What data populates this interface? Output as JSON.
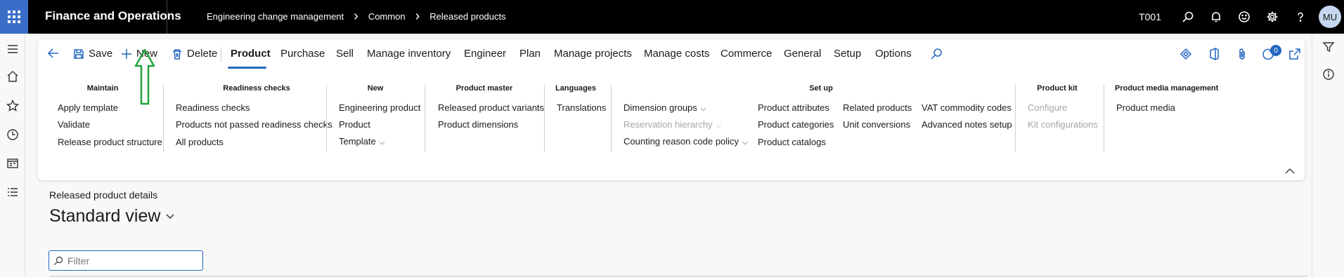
{
  "topbar": {
    "app_name": "Finance and Operations",
    "breadcrumbs": [
      "Engineering change management",
      "Common",
      "Released products"
    ],
    "company": "T001",
    "user_initials": "MU"
  },
  "actionbar": {
    "commands": {
      "save": "Save",
      "new": "New",
      "delete": "Delete"
    },
    "tabs": [
      "Product",
      "Purchase",
      "Sell",
      "Manage inventory",
      "Engineer",
      "Plan",
      "Manage projects",
      "Manage costs",
      "Commerce",
      "General",
      "Setup",
      "Options"
    ],
    "active_tab": "Product",
    "notification_count": "0"
  },
  "groups": {
    "maintain": {
      "title": "Maintain",
      "items": [
        "Apply template",
        "Validate",
        "Release product structure"
      ]
    },
    "readiness": {
      "title": "Readiness checks",
      "items": [
        "Readiness checks",
        "Products not passed readiness checks",
        "All products"
      ]
    },
    "new": {
      "title": "New",
      "items": [
        "Engineering product",
        "Product",
        "Template"
      ]
    },
    "product_master": {
      "title": "Product master",
      "items": [
        "Released product variants",
        "Product dimensions"
      ]
    },
    "languages": {
      "title": "Languages",
      "items": [
        "Translations"
      ]
    },
    "setup": {
      "title": "Set up",
      "col1": [
        "Dimension groups",
        "Reservation hierarchy",
        "Counting reason code policy"
      ],
      "col2": [
        "Product attributes",
        "Product categories",
        "Product catalogs"
      ],
      "col3": [
        "Related products",
        "Unit conversions"
      ],
      "col4": [
        "VAT commodity codes",
        "Advanced notes setup"
      ]
    },
    "product_kit": {
      "title": "Product kit",
      "items": [
        "Configure",
        "Kit configurations"
      ]
    },
    "media": {
      "title": "Product media management",
      "items": [
        "Product media"
      ]
    }
  },
  "page": {
    "details_label": "Released product details",
    "view_name": "Standard view",
    "filter_placeholder": "Filter"
  },
  "colors": {
    "accent": "#2266c0",
    "waffle": "#3a6dc7",
    "annotation_arrow": "#22a33a"
  }
}
